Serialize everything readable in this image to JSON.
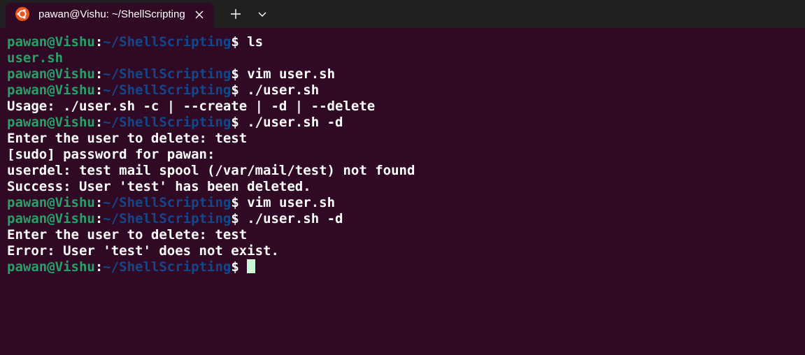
{
  "tab": {
    "title": "pawan@Vishu: ~/ShellScripting"
  },
  "colors": {
    "background": "#300a24",
    "titlebar": "#202020",
    "prompt_user": "#26a269",
    "prompt_path": "#12488b",
    "ubuntu_orange": "#e95420"
  },
  "icons": {
    "app": "ubuntu-logo-icon",
    "close": "close-icon",
    "new_tab": "plus-icon",
    "dropdown": "chevron-down-icon"
  },
  "prompt": {
    "user_host": "pawan@Vishu",
    "sep": ":",
    "path": "~/ShellScripting",
    "dollar": "$ "
  },
  "lines": [
    {
      "type": "cmd",
      "text": "ls"
    },
    {
      "type": "file",
      "text": "user.sh"
    },
    {
      "type": "cmd",
      "text": "vim user.sh"
    },
    {
      "type": "cmd",
      "text": "./user.sh"
    },
    {
      "type": "out",
      "text": "Usage: ./user.sh -c | --create | -d | --delete"
    },
    {
      "type": "cmd",
      "text": "./user.sh -d"
    },
    {
      "type": "out",
      "text": "Enter the user to delete: test"
    },
    {
      "type": "out",
      "text": "[sudo] password for pawan:"
    },
    {
      "type": "out",
      "text": "userdel: test mail spool (/var/mail/test) not found"
    },
    {
      "type": "out",
      "text": "Success: User 'test' has been deleted."
    },
    {
      "type": "cmd",
      "text": "vim user.sh"
    },
    {
      "type": "cmd",
      "text": "./user.sh -d"
    },
    {
      "type": "out",
      "text": "Enter the user to delete: test"
    },
    {
      "type": "out",
      "text": "Error: User 'test' does not exist."
    },
    {
      "type": "cmd",
      "text": "",
      "cursor": true
    }
  ]
}
